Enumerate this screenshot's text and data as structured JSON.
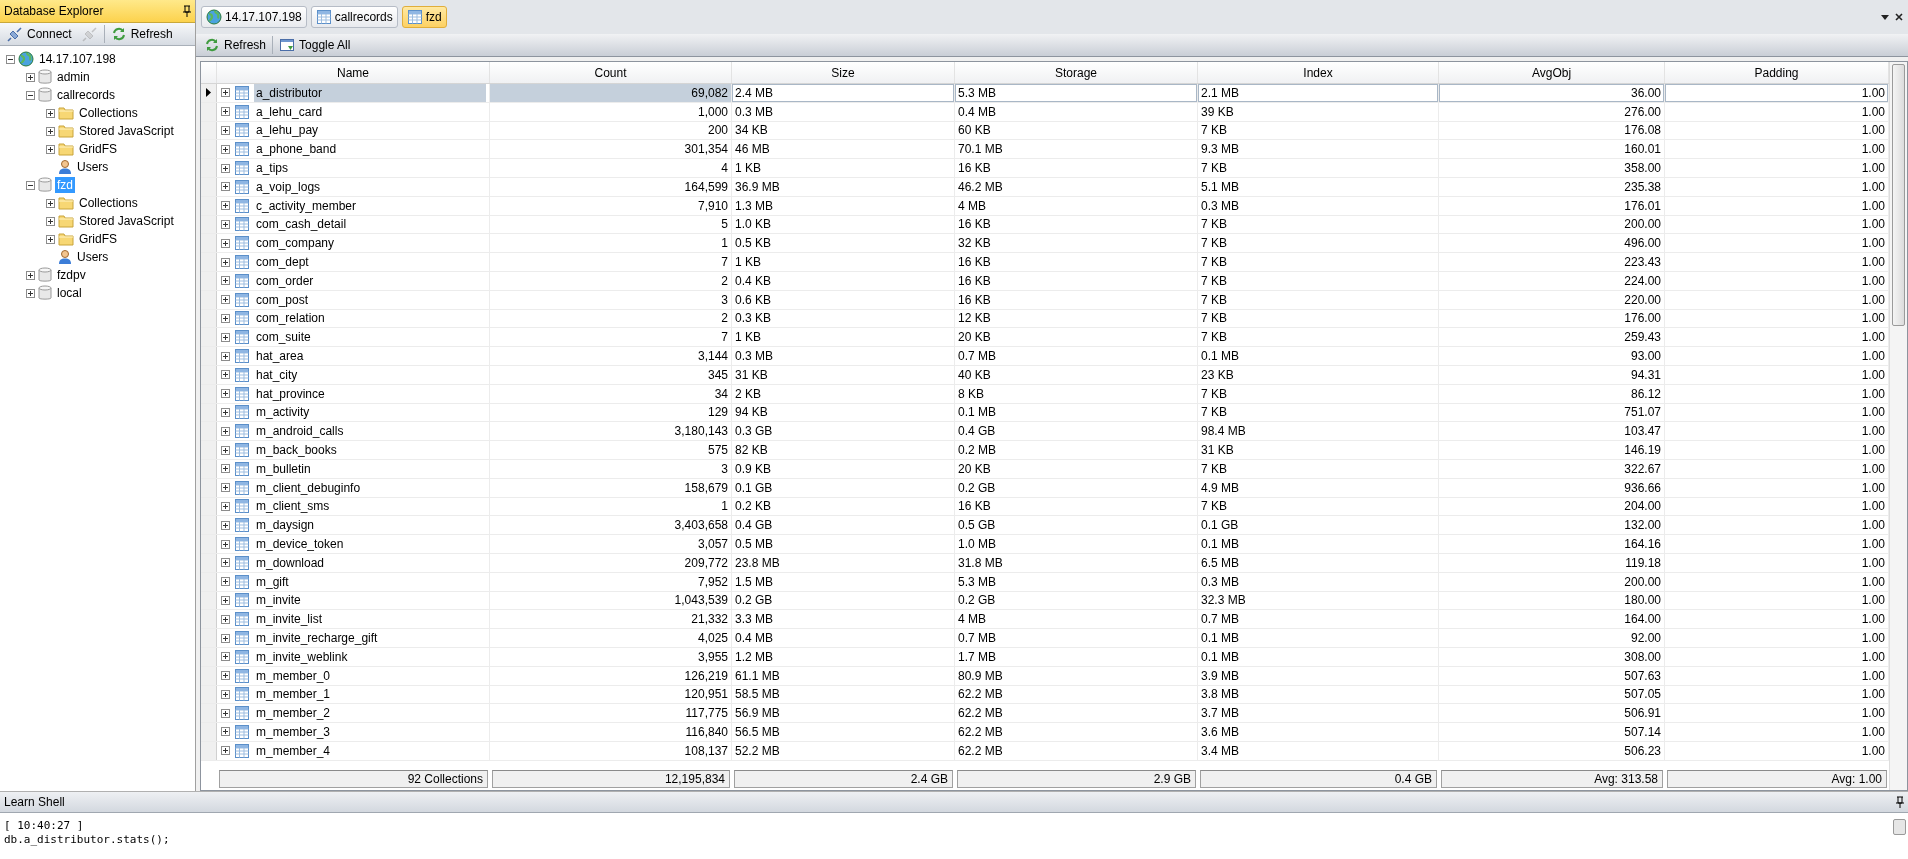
{
  "sidebar": {
    "title": "Database Explorer",
    "toolbar": [
      {
        "kind": "connect",
        "label": "Connect",
        "disabled": false
      },
      {
        "kind": "disconnect",
        "disabled": true
      },
      {
        "kind": "refresh",
        "label": "Refresh",
        "disabled": false
      }
    ],
    "tree": [
      {
        "label": "14.17.107.198",
        "kind": "server",
        "expanded": true,
        "selected": false,
        "children": [
          {
            "label": "admin",
            "kind": "database",
            "expanded": false,
            "selected": false
          },
          {
            "label": "callrecords",
            "kind": "database",
            "expanded": true,
            "selected": false,
            "children": [
              {
                "label": "Collections",
                "kind": "folder",
                "expanded": false,
                "selected": false
              },
              {
                "label": "Stored JavaScript",
                "kind": "folder",
                "expanded": false,
                "selected": false
              },
              {
                "label": "GridFS",
                "kind": "folder",
                "expanded": false,
                "selected": false
              },
              {
                "label": "Users",
                "kind": "users",
                "selected": false
              }
            ]
          },
          {
            "label": "fzd",
            "kind": "database",
            "expanded": true,
            "selected": true,
            "children": [
              {
                "label": "Collections",
                "kind": "folder",
                "expanded": false,
                "selected": false
              },
              {
                "label": "Stored JavaScript",
                "kind": "folder",
                "expanded": false,
                "selected": false
              },
              {
                "label": "GridFS",
                "kind": "folder",
                "expanded": false,
                "selected": false
              },
              {
                "label": "Users",
                "kind": "users",
                "selected": false
              }
            ]
          },
          {
            "label": "fzdpv",
            "kind": "database",
            "expanded": false,
            "selected": false
          },
          {
            "label": "local",
            "kind": "database",
            "expanded": false,
            "selected": false
          }
        ]
      }
    ]
  },
  "tabs": [
    {
      "label": "14.17.107.198",
      "kind": "server",
      "selected": false
    },
    {
      "label": "callrecords",
      "kind": "database",
      "selected": false
    },
    {
      "label": "fzd",
      "kind": "database",
      "selected": true
    }
  ],
  "toolbar": [
    {
      "kind": "refresh",
      "label": "Refresh"
    },
    {
      "kind": "toggle",
      "label": "Toggle All"
    }
  ],
  "table": {
    "columns": [
      "Name",
      "Count",
      "Size",
      "Storage",
      "Index",
      "AvgObj",
      "Padding"
    ],
    "rows": [
      {
        "selected": true,
        "cells": [
          "a_distributor",
          "69,082",
          "2.4 MB",
          "5.3 MB",
          "2.1 MB",
          "36.00",
          "1.00"
        ]
      },
      {
        "selected": false,
        "cells": [
          "a_lehu_card",
          "1,000",
          "0.3 MB",
          "0.4 MB",
          "39 KB",
          "276.00",
          "1.00"
        ]
      },
      {
        "selected": false,
        "cells": [
          "a_lehu_pay",
          "200",
          "34 KB",
          "60 KB",
          "7 KB",
          "176.08",
          "1.00"
        ]
      },
      {
        "selected": false,
        "cells": [
          "a_phone_band",
          "301,354",
          "46 MB",
          "70.1 MB",
          "9.3 MB",
          "160.01",
          "1.00"
        ]
      },
      {
        "selected": false,
        "cells": [
          "a_tips",
          "4",
          "1 KB",
          "16 KB",
          "7 KB",
          "358.00",
          "1.00"
        ]
      },
      {
        "selected": false,
        "cells": [
          "a_voip_logs",
          "164,599",
          "36.9 MB",
          "46.2 MB",
          "5.1 MB",
          "235.38",
          "1.00"
        ]
      },
      {
        "selected": false,
        "cells": [
          "c_activity_member",
          "7,910",
          "1.3 MB",
          "4 MB",
          "0.3 MB",
          "176.01",
          "1.00"
        ]
      },
      {
        "selected": false,
        "cells": [
          "com_cash_detail",
          "5",
          "1.0 KB",
          "16 KB",
          "7 KB",
          "200.00",
          "1.00"
        ]
      },
      {
        "selected": false,
        "cells": [
          "com_company",
          "1",
          "0.5 KB",
          "32 KB",
          "7 KB",
          "496.00",
          "1.00"
        ]
      },
      {
        "selected": false,
        "cells": [
          "com_dept",
          "7",
          "1 KB",
          "16 KB",
          "7 KB",
          "223.43",
          "1.00"
        ]
      },
      {
        "selected": false,
        "cells": [
          "com_order",
          "2",
          "0.4 KB",
          "16 KB",
          "7 KB",
          "224.00",
          "1.00"
        ]
      },
      {
        "selected": false,
        "cells": [
          "com_post",
          "3",
          "0.6 KB",
          "16 KB",
          "7 KB",
          "220.00",
          "1.00"
        ]
      },
      {
        "selected": false,
        "cells": [
          "com_relation",
          "2",
          "0.3 KB",
          "12 KB",
          "7 KB",
          "176.00",
          "1.00"
        ]
      },
      {
        "selected": false,
        "cells": [
          "com_suite",
          "7",
          "1 KB",
          "20 KB",
          "7 KB",
          "259.43",
          "1.00"
        ]
      },
      {
        "selected": false,
        "cells": [
          "hat_area",
          "3,144",
          "0.3 MB",
          "0.7 MB",
          "0.1 MB",
          "93.00",
          "1.00"
        ]
      },
      {
        "selected": false,
        "cells": [
          "hat_city",
          "345",
          "31 KB",
          "40 KB",
          "23 KB",
          "94.31",
          "1.00"
        ]
      },
      {
        "selected": false,
        "cells": [
          "hat_province",
          "34",
          "2 KB",
          "8 KB",
          "7 KB",
          "86.12",
          "1.00"
        ]
      },
      {
        "selected": false,
        "cells": [
          "m_activity",
          "129",
          "94 KB",
          "0.1 MB",
          "7 KB",
          "751.07",
          "1.00"
        ]
      },
      {
        "selected": false,
        "cells": [
          "m_android_calls",
          "3,180,143",
          "0.3 GB",
          "0.4 GB",
          "98.4 MB",
          "103.47",
          "1.00"
        ]
      },
      {
        "selected": false,
        "cells": [
          "m_back_books",
          "575",
          "82 KB",
          "0.2 MB",
          "31 KB",
          "146.19",
          "1.00"
        ]
      },
      {
        "selected": false,
        "cells": [
          "m_bulletin",
          "3",
          "0.9 KB",
          "20 KB",
          "7 KB",
          "322.67",
          "1.00"
        ]
      },
      {
        "selected": false,
        "cells": [
          "m_client_debuginfo",
          "158,679",
          "0.1 GB",
          "0.2 GB",
          "4.9 MB",
          "936.66",
          "1.00"
        ]
      },
      {
        "selected": false,
        "cells": [
          "m_client_sms",
          "1",
          "0.2 KB",
          "16 KB",
          "7 KB",
          "204.00",
          "1.00"
        ]
      },
      {
        "selected": false,
        "cells": [
          "m_daysign",
          "3,403,658",
          "0.4 GB",
          "0.5 GB",
          "0.1 GB",
          "132.00",
          "1.00"
        ]
      },
      {
        "selected": false,
        "cells": [
          "m_device_token",
          "3,057",
          "0.5 MB",
          "1.0 MB",
          "0.1 MB",
          "164.16",
          "1.00"
        ]
      },
      {
        "selected": false,
        "cells": [
          "m_download",
          "209,772",
          "23.8 MB",
          "31.8 MB",
          "6.5 MB",
          "119.18",
          "1.00"
        ]
      },
      {
        "selected": false,
        "cells": [
          "m_gift",
          "7,952",
          "1.5 MB",
          "5.3 MB",
          "0.3 MB",
          "200.00",
          "1.00"
        ]
      },
      {
        "selected": false,
        "cells": [
          "m_invite",
          "1,043,539",
          "0.2 GB",
          "0.2 GB",
          "32.3 MB",
          "180.00",
          "1.00"
        ]
      },
      {
        "selected": false,
        "cells": [
          "m_invite_list",
          "21,332",
          "3.3 MB",
          "4 MB",
          "0.7 MB",
          "164.00",
          "1.00"
        ]
      },
      {
        "selected": false,
        "cells": [
          "m_invite_recharge_gift",
          "4,025",
          "0.4 MB",
          "0.7 MB",
          "0.1 MB",
          "92.00",
          "1.00"
        ]
      },
      {
        "selected": false,
        "cells": [
          "m_invite_weblink",
          "3,955",
          "1.2 MB",
          "1.7 MB",
          "0.1 MB",
          "308.00",
          "1.00"
        ]
      },
      {
        "selected": false,
        "cells": [
          "m_member_0",
          "126,219",
          "61.1 MB",
          "80.9 MB",
          "3.9 MB",
          "507.63",
          "1.00"
        ]
      },
      {
        "selected": false,
        "cells": [
          "m_member_1",
          "120,951",
          "58.5 MB",
          "62.2 MB",
          "3.8 MB",
          "507.05",
          "1.00"
        ]
      },
      {
        "selected": false,
        "cells": [
          "m_member_2",
          "117,775",
          "56.9 MB",
          "62.2 MB",
          "3.7 MB",
          "506.91",
          "1.00"
        ]
      },
      {
        "selected": false,
        "cells": [
          "m_member_3",
          "116,840",
          "56.5 MB",
          "62.2 MB",
          "3.6 MB",
          "507.14",
          "1.00"
        ]
      },
      {
        "selected": false,
        "cells": [
          "m_member_4",
          "108,137",
          "52.2 MB",
          "62.2 MB",
          "3.4 MB",
          "506.23",
          "1.00"
        ]
      }
    ],
    "footer": [
      "92 Collections",
      "12,195,834",
      "2.4 GB",
      "2.9 GB",
      "0.4 GB",
      "Avg: 313.58",
      "Avg: 1.00"
    ]
  },
  "shell": {
    "title": "Learn Shell",
    "lines": [
      "[ 10:40:27 ]",
      "db.a_distributor.stats();"
    ]
  }
}
